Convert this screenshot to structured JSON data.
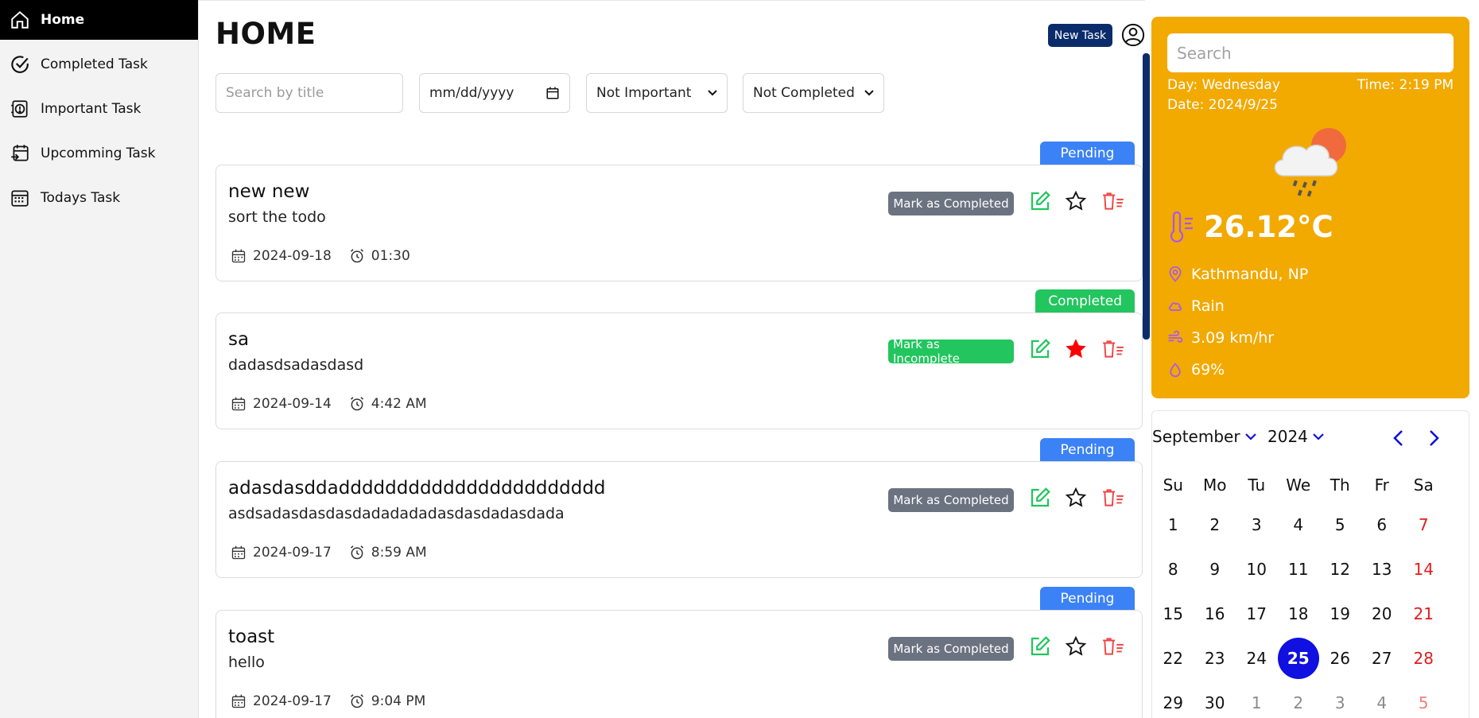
{
  "sidebar": {
    "items": [
      {
        "label": "Home",
        "icon": "home-icon",
        "active": true
      },
      {
        "label": "Completed Task",
        "icon": "check-circle-icon"
      },
      {
        "label": "Important Task",
        "icon": "important-icon"
      },
      {
        "label": "Upcomming Task",
        "icon": "upcoming-icon"
      },
      {
        "label": "Todays Task",
        "icon": "calendar-icon"
      }
    ]
  },
  "header": {
    "title": "HOME",
    "new_task_label": "New Task"
  },
  "filters": {
    "search_placeholder": "Search by title",
    "date_placeholder": "mm/dd/yyyy",
    "importance_selected": "Not Important",
    "completion_selected": "Not Completed"
  },
  "tasks": [
    {
      "status": "Pending",
      "title": "new new",
      "description": "sort the todo",
      "date": "2024-09-18",
      "time": "01:30",
      "action_label": "Mark as Completed",
      "important": false
    },
    {
      "status": "Completed",
      "title": "sa",
      "description": "dadasdsadasdasd",
      "date": "2024-09-14",
      "time": "4:42 AM",
      "action_label": "Mark as Incomplete",
      "important": true
    },
    {
      "status": "Pending",
      "title": "adasdasddaddddddddddddddddddddddd",
      "description": "asdsadasdasdasdadadadadasdasdadasdada",
      "date": "2024-09-17",
      "time": "8:59 AM",
      "action_label": "Mark as Completed",
      "important": false
    },
    {
      "status": "Pending",
      "title": "toast",
      "description": "hello",
      "date": "2024-09-17",
      "time": "9:04 PM",
      "action_label": "Mark as Completed",
      "important": false
    }
  ],
  "weather": {
    "search_placeholder": "Search",
    "day": "Day: Wednesday",
    "time": "Time: 2:19 PM",
    "date": "Date: 2024/9/25",
    "temperature": "26.12°C",
    "location": "Kathmandu, NP",
    "condition": "Rain",
    "wind": "3.09 km/hr",
    "humidity": "69%",
    "colors": {
      "panel": "#f2a900",
      "accent_icon": "#a855f7"
    }
  },
  "calendar": {
    "month": "September",
    "year": "2024",
    "weekdays": [
      "Su",
      "Mo",
      "Tu",
      "We",
      "Th",
      "Fr",
      "Sa"
    ],
    "days": [
      [
        "1",
        "2",
        "3",
        "4",
        "5",
        "6",
        "7"
      ],
      [
        "8",
        "9",
        "10",
        "11",
        "12",
        "13",
        "14"
      ],
      [
        "15",
        "16",
        "17",
        "18",
        "19",
        "20",
        "21"
      ],
      [
        "22",
        "23",
        "24",
        "25",
        "26",
        "27",
        "28"
      ],
      [
        "29",
        "30",
        "1",
        "2",
        "3",
        "4",
        "5"
      ]
    ],
    "selected": "25",
    "colors": {
      "selected": "#1010e0",
      "weekend": "#e11d1d"
    }
  }
}
